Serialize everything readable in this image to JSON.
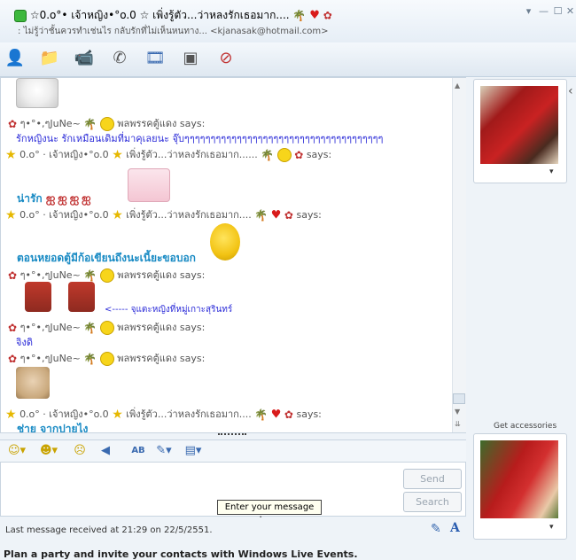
{
  "window": {
    "title": "☆0.o°• เจ้าหญิง•°o.0 ☆ เพิ่งรู้ตัว...ว่าหลงรักเธอมาก....",
    "subtitle": ": ไม่รู้ว่าชั้นควรทำเช่นไร กลับรักที่ไม่เห็นหนทาง... <kjanasak@hotmail.com>",
    "controls": [
      "▾",
      "—",
      "☐",
      "✕"
    ]
  },
  "toolbar": {
    "icons": [
      "invite-contact-icon",
      "share-files-icon",
      "video-call-icon",
      "phone-call-icon",
      "games-icon",
      "activities-icon",
      "block-icon"
    ]
  },
  "conversation": {
    "lines": [
      {
        "kind": "sender",
        "name": "ๆ•°•,ๆJuNe~",
        "says": "พลพรรคตู้แดง says:"
      },
      {
        "kind": "msg-blue",
        "text": "รักหญิงนะ รักเหมือนเดิมที่มาคุเลยนะ จุ๊บๆๆๆๆๆๆๆๆๆๆๆๆๆๆๆๆๆๆๆๆๆๆๆๆๆๆๆๆๆๆๆๆๆๆๆๆๆๆ"
      },
      {
        "kind": "sender2",
        "name": "0.o° · เจ้าหญิง•°o.0",
        "after": "เพิ่งรู้ตัว...ว่าหลงรักเธอมาก......",
        "says": "says:"
      },
      {
        "kind": "msg-teal",
        "text": "น่ารัก"
      },
      {
        "kind": "sender2",
        "name": "0.o° · เจ้าหญิง•°o.0",
        "after": "เพิ่งรู้ตัว...ว่าหลงรักเธอมาก....",
        "says": "says:"
      },
      {
        "kind": "msg-teal",
        "text": "ตอนหยอดตู้มีก้อเขียนถึงนะเนี้ยะขอบอก"
      },
      {
        "kind": "sender",
        "name": "ๆ•°•,ๆJuNe~",
        "says": "พลพรรคตู้แดง says:"
      },
      {
        "kind": "msg-blue",
        "text": "<----- จุแตะหญิงที่หมู่เกาะสุรินทร์"
      },
      {
        "kind": "sender",
        "name": "ๆ•°•,ๆJuNe~",
        "says": "พลพรรคตู้แดง says:"
      },
      {
        "kind": "msg-blue",
        "text": "จิงดิ"
      },
      {
        "kind": "sender",
        "name": "ๆ•°•,ๆJuNe~",
        "says": "พลพรรคตู้แดง says:"
      },
      {
        "kind": "sender2",
        "name": "0.o° · เจ้าหญิง•°o.0",
        "after": "เพิ่งรู้ตัว...ว่าหลงรักเธอมาก....",
        "says": "says:"
      },
      {
        "kind": "msg-teal",
        "text": "ช่าย จากปายไง"
      }
    ]
  },
  "format_toolbar": {
    "icons": [
      "emoticon-icon",
      "wink-icon",
      "nudge-icon",
      "voice-clip-icon",
      "font-icon",
      "color-icon",
      "background-icon"
    ]
  },
  "input": {
    "send_label": "Send",
    "search_label": "Search",
    "tooltip": "Enter your message here"
  },
  "status": {
    "last_message": "Last message received at 21:29 on 22/5/2551."
  },
  "footer": {
    "text": "Plan a party and invite your contacts with Windows Live Events."
  },
  "side": {
    "get_accessories": "Get accessories",
    "collapse": "‹",
    "dropdown": "▾"
  },
  "colors": {
    "accent": "#2b2bd8",
    "teal": "#1a8bc4",
    "photo_red": "#b71c1c"
  }
}
